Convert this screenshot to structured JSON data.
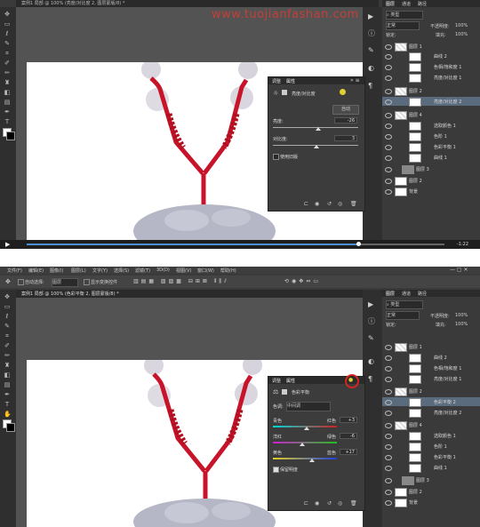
{
  "watermark": "www.tuojianfashan.com",
  "top": {
    "tab_title": "案例1 局部 @ 100% (亮度/对比度 2, 图层蒙版/8) *",
    "layer_filter": "类型",
    "blend_mode": "正常",
    "opacity_label": "不透明度:",
    "opacity_value": "100%",
    "lock_label": "锁定:",
    "fill_label": "填充:",
    "fill_value": "100%",
    "panel_tabs": [
      "图层",
      "通道",
      "路径"
    ],
    "properties": {
      "tabs": [
        "调整",
        "属性"
      ],
      "type": "亮度/对比度",
      "auto": "自动",
      "brightness_label": "亮度:",
      "brightness_value": "-26",
      "contrast_label": "对比度:",
      "contrast_value": "3",
      "legacy": "使用旧版"
    },
    "layers": [
      "图层 1",
      "曲线 2",
      "色相/饱和度 1",
      "亮度/对比度 1",
      "图层 2",
      "亮度/对比度 2",
      "图层 4",
      "选取颜色 1",
      "色阶 1",
      "色彩平衡 1",
      "曲线 1",
      "图层 3",
      "图层 2",
      "背景"
    ],
    "video_time": "-1:22"
  },
  "bottom": {
    "menu": [
      "文件(F)",
      "编辑(E)",
      "图像(I)",
      "图层(L)",
      "文字(Y)",
      "选择(S)",
      "滤镜(T)",
      "3D(D)",
      "视图(V)",
      "窗口(W)",
      "帮助(H)"
    ],
    "options_auto_select": "自动选择:",
    "options_layer": "图层",
    "options_transform": "显示变换控件",
    "tab_title": "案例1 局部 @ 100% (色彩平衡 2, 图层蒙版/8) *",
    "layer_filter": "类型",
    "blend_mode": "正常",
    "opacity_label": "不透明度:",
    "opacity_value": "100%",
    "lock_label": "锁定:",
    "fill_label": "填充:",
    "fill_value": "100%",
    "panel_tabs": [
      "图层",
      "通道",
      "路径"
    ],
    "properties": {
      "tabs": [
        "调整",
        "属性"
      ],
      "type": "色彩平衡",
      "tone_label": "色调:",
      "tone_value": "中间调",
      "cyan": "青色",
      "red": "红色",
      "cr_value": "+3",
      "magenta": "洋红",
      "green": "绿色",
      "mg_value": "-6",
      "yellow": "黄色",
      "blue": "蓝色",
      "yb_value": "+17",
      "preserve": "保留明度"
    },
    "layers": [
      "图层 1",
      "曲线 2",
      "色相/饱和度 1",
      "亮度/对比度 1",
      "图层 2",
      "色彩平衡 2",
      "亮度/对比度 2",
      "图层 4",
      "选取颜色 1",
      "色阶 1",
      "色彩平衡 1",
      "曲线 1",
      "图层 3",
      "图层 2",
      "背景"
    ]
  },
  "colors": {
    "accent": "#4a90d9",
    "selected": "#5a6b7e",
    "cord": "#d0182a",
    "highlight_circle": "#d8231f"
  }
}
